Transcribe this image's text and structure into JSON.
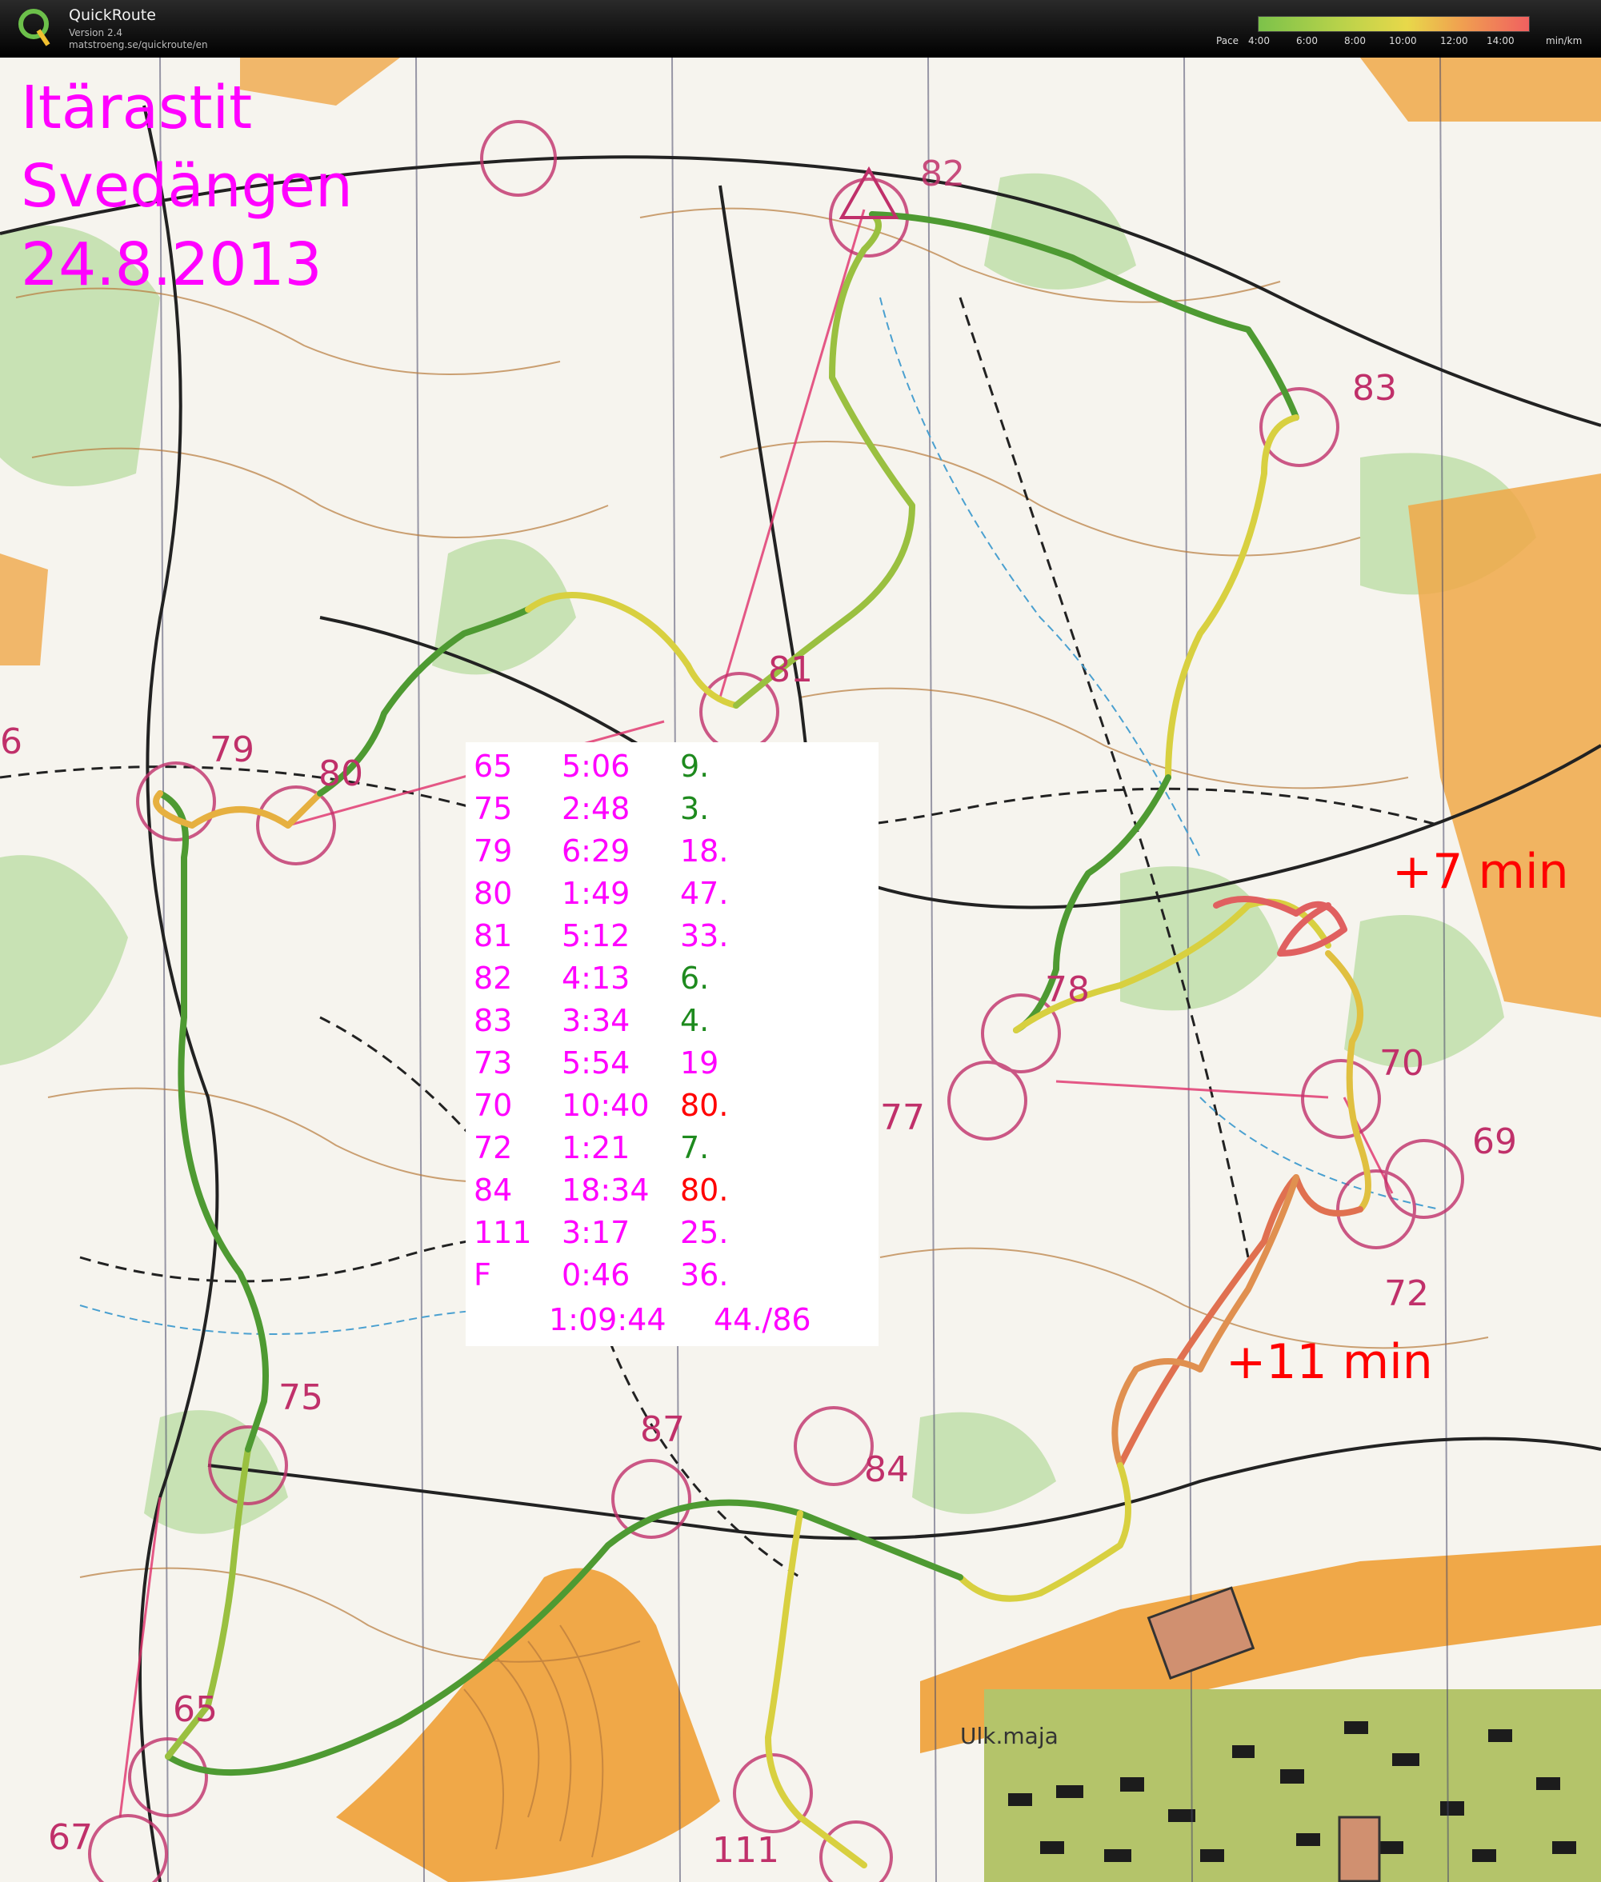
{
  "app": {
    "name": "QuickRoute",
    "version": "Version 2.4",
    "url": "matstroeng.se/quickroute/en",
    "pace_label": "Pace",
    "pace_ticks": [
      "4:00",
      "6:00",
      "8:00",
      "10:00",
      "12:00",
      "14:00"
    ],
    "pace_unit": "min/km"
  },
  "title": {
    "line1": "Itärastit",
    "line2": "Svedängen",
    "line3": "24.8.2013"
  },
  "splits": [
    {
      "control": "65",
      "time": "5:06",
      "rank": "9.",
      "color": "#1e8a1e"
    },
    {
      "control": "75",
      "time": "2:48",
      "rank": "3.",
      "color": "#1e8a1e"
    },
    {
      "control": "79",
      "time": "6:29",
      "rank": "18.",
      "color": "#ff00ff"
    },
    {
      "control": "80",
      "time": "1:49",
      "rank": "47.",
      "color": "#ff00ff"
    },
    {
      "control": "81",
      "time": "5:12",
      "rank": "33.",
      "color": "#ff00ff"
    },
    {
      "control": "82",
      "time": "4:13",
      "rank": "6.",
      "color": "#1e8a1e"
    },
    {
      "control": "83",
      "time": "3:34",
      "rank": "4.",
      "color": "#1e8a1e"
    },
    {
      "control": "73",
      "time": "5:54",
      "rank": "19",
      "color": "#ff00ff"
    },
    {
      "control": "70",
      "time": "10:40",
      "rank": "80.",
      "color": "#ff0000"
    },
    {
      "control": "72",
      "time": "1:21",
      "rank": "7.",
      "color": "#1e8a1e"
    },
    {
      "control": "84",
      "time": "18:34",
      "rank": "80.",
      "color": "#ff0000"
    },
    {
      "control": "111",
      "time": "3:17",
      "rank": "25.",
      "color": "#ff00ff"
    },
    {
      "control": "F",
      "time": "0:46",
      "rank": "36.",
      "color": "#ff00ff"
    }
  ],
  "total": {
    "time": "1:09:44",
    "rank": "44./86"
  },
  "notes": {
    "lost_70": "+7 min",
    "lost_84": "+11 min"
  },
  "control_labels": [
    "82",
    "83",
    "81",
    "79",
    "80",
    "78",
    "77",
    "70",
    "69",
    "72",
    "75",
    "87",
    "84",
    "65",
    "67",
    "111",
    "6"
  ],
  "place_label": "Ulk.maja"
}
